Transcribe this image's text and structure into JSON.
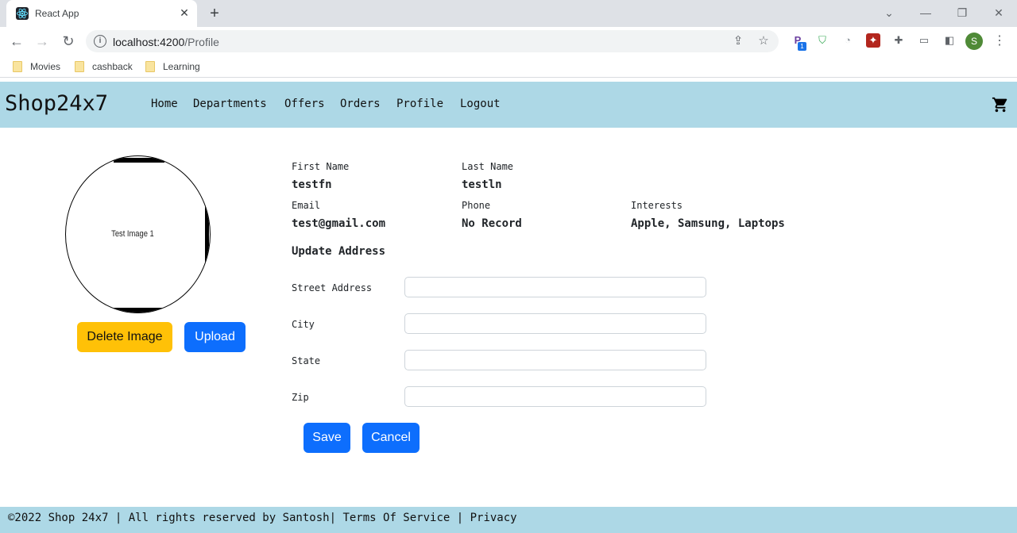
{
  "browser": {
    "tab_title": "React App",
    "tab_close": "✕",
    "new_tab": "+",
    "url_host": "localhost:4200",
    "url_path": "/Profile",
    "avatar_initial": "S",
    "ext_badge": "1",
    "bookmarks": [
      {
        "label": "Movies"
      },
      {
        "label": "cashback"
      },
      {
        "label": "Learning"
      }
    ],
    "icons": [
      "back-icon",
      "forward-icon",
      "reload-icon",
      "info-icon",
      "share-icon",
      "star-icon",
      "extensions-icon",
      "cast-icon",
      "side-panel-icon",
      "menu-icon"
    ]
  },
  "app": {
    "brand": "Shop24x7",
    "nav": {
      "home": "Home",
      "departments": "Departments",
      "offers": "Offers",
      "orders": "Orders",
      "profile": "Profile",
      "logout": "Logout"
    },
    "cart_icon": "cart-icon",
    "nav_bg": "#add8e6"
  },
  "profile": {
    "image_caption": "Test Image 1",
    "delete_label": "Delete Image",
    "upload_label": "Upload",
    "first_name_label": "First Name",
    "first_name": "testfn",
    "last_name_label": "Last Name",
    "last_name": "testln",
    "email_label": "Email",
    "email": "test@gmail.com",
    "phone_label": "Phone",
    "phone": "No Record",
    "interests_label": "Interests",
    "interests": "Apple, Samsung, Laptops"
  },
  "address_form": {
    "title": "Update Address",
    "street_label": "Street Address",
    "street_value": "",
    "city_label": "City",
    "city_value": "",
    "state_label": "State",
    "state_value": "",
    "zip_label": "Zip",
    "zip_value": "",
    "save_label": "Save",
    "cancel_label": "Cancel"
  },
  "footer": {
    "copyright": "©2022 Shop 24x7 | All rights reserved by Santosh| ",
    "terms": "Terms Of Service",
    "separator": " | ",
    "privacy": "Privacy"
  },
  "colors": {
    "primary": "#0d6efd",
    "warning": "#ffc107",
    "accent": "#add8e6"
  }
}
